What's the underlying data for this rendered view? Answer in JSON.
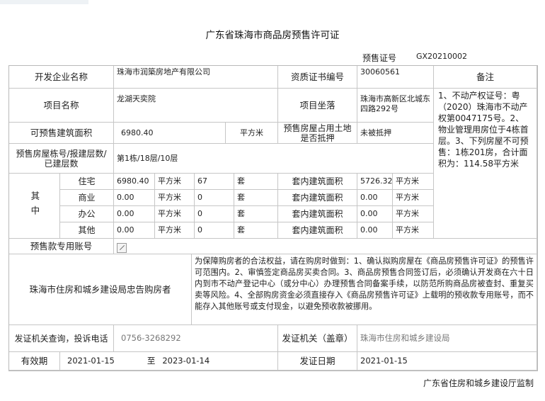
{
  "title": "广东省珠海市商品房预售许可证",
  "permit": {
    "label": "预售证号",
    "value": "GX20210002"
  },
  "developer": {
    "label": "开发企业名称",
    "value": "珠海市润築房地产有限公司"
  },
  "qualification": {
    "label": "资质证书编号",
    "value": "30060561"
  },
  "remarks": {
    "label": "备注",
    "text": "1、不动产权证号：粤（2020）珠海市不动产权第0047175号。2、物业管理用房位于4栋首层。3、下列房屋不可预售：1栋201房，合计面积为：114.58平方米"
  },
  "project": {
    "label": "项目名称",
    "value": "龙湖天奕院"
  },
  "location": {
    "label": "项目坐落",
    "value": "珠海市高新区北城东四路292号"
  },
  "presale_area": {
    "label": "可预售建筑面积",
    "value": "6980.40",
    "unit": "平方米"
  },
  "land_mortgage": {
    "label": "预售房屋占用土地是否抵押",
    "value": "未被抵押"
  },
  "buildings": {
    "label": "预售房屋栋号/报建层数/已建层数",
    "value": "第1栋/18层/10层"
  },
  "breakdown": {
    "label": "其中",
    "rows": [
      {
        "type": "住宅",
        "area": "6980.40",
        "area_unit": "平方米",
        "count": "67",
        "count_unit": "套",
        "inner_label": "套内建筑面积",
        "inner_area": "5726.32",
        "inner_unit": "平方米"
      },
      {
        "type": "商业",
        "area": "0.00",
        "area_unit": "平方米",
        "count": "0",
        "count_unit": "套",
        "inner_label": "套内建筑面积",
        "inner_area": "0.00",
        "inner_unit": "平方米"
      },
      {
        "type": "办公",
        "area": "0.00",
        "area_unit": "平方米",
        "count": "0",
        "count_unit": "套",
        "inner_label": "套内建筑面积",
        "inner_area": "0.00",
        "inner_unit": "平方米"
      },
      {
        "type": "其他",
        "area": "0.00",
        "area_unit": "平方米",
        "count": "0",
        "count_unit": "套",
        "inner_label": "套内建筑面积",
        "inner_area": "0.00",
        "inner_unit": "平方米"
      }
    ]
  },
  "escrow": {
    "label": "预售款专用账号"
  },
  "warning": {
    "label": "珠海市住房和城乡建设局忠告购房者",
    "text": "为保障购房者的合法权益，请在购房时做到：1、确认拟购房屋在《商品房预售许可证》的预售许可范围内。2、审慎签定商品房买卖合同。3、商品房预售合同签订后，必须确认开发商在六十日内到市不动产登记中心（或分中心）办理预售合同备案手续，以防范所购商品房被查封、重复买卖等风险。4、全部购房资金必须直接存入《商品房预售许可证》上载明的预收款专用账号，而不能存入其他账号或支付现金，以避免预收款被挪用。"
  },
  "hotline": {
    "label": "发证机关查询，投诉电话",
    "value": "0756-3268292"
  },
  "issuer": {
    "label": "发证机关（盖章）",
    "value": "珠海市住房和城乡建设局"
  },
  "validity": {
    "label": "有效期",
    "from": "2021-01-15",
    "sep": "至",
    "to": "2023-01-14"
  },
  "issue_date": {
    "label": "发证日期",
    "value": "2021-01-15"
  },
  "footer": "广东省住房和城乡建设厅监制"
}
